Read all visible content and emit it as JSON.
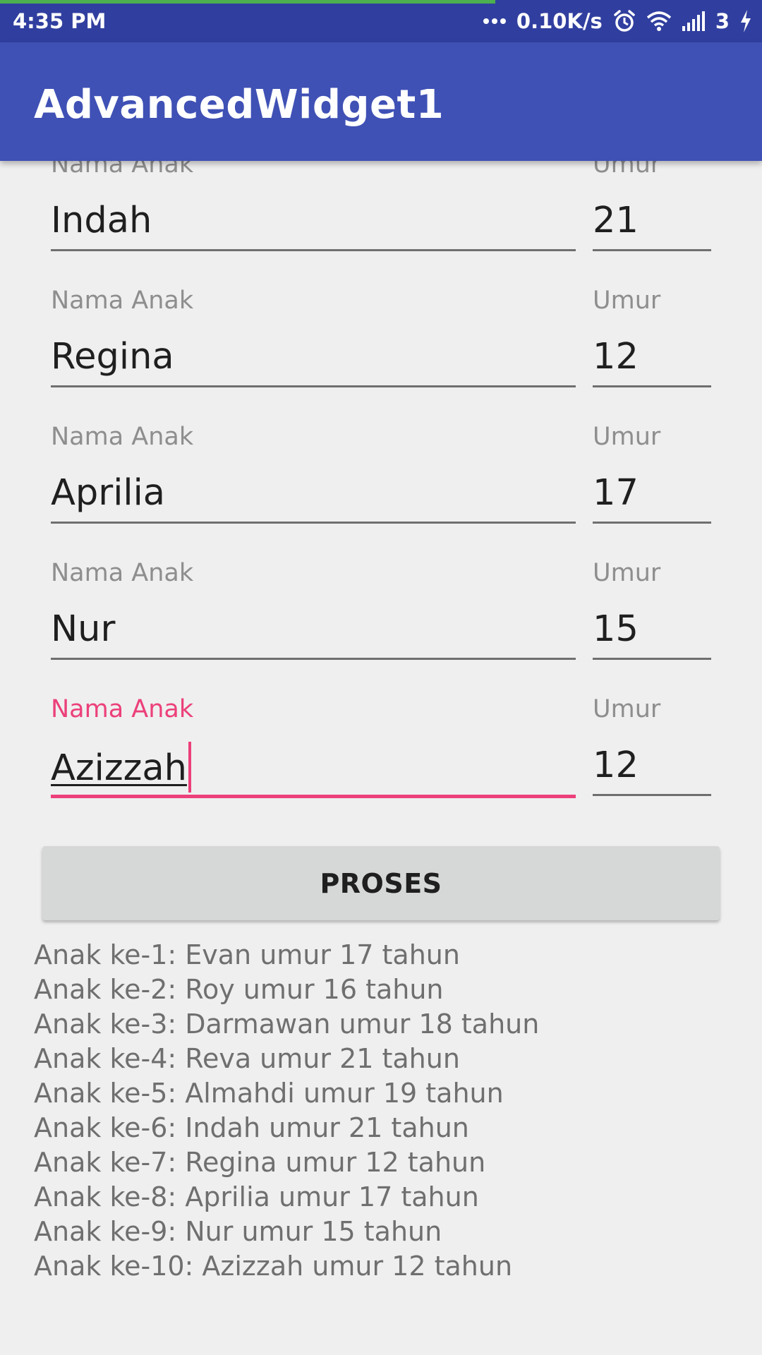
{
  "status_bar": {
    "time": "4:35 PM",
    "network_speed": "0.10K/s",
    "sim_label": "3",
    "icons": [
      "more-dots-icon",
      "alarm-icon",
      "wifi-icon",
      "signal-icon",
      "charging-bolt-icon"
    ],
    "page_load_progress": 0.65
  },
  "app_bar": {
    "title": "AdvancedWidget1"
  },
  "form": {
    "name_label": "Nama Anak",
    "age_label": "Umur",
    "rows": [
      {
        "name": "Indah",
        "age": "21"
      },
      {
        "name": "Regina",
        "age": "12"
      },
      {
        "name": "Aprilia",
        "age": "17"
      },
      {
        "name": "Nur",
        "age": "15"
      },
      {
        "name": "Azizzah",
        "age": "12",
        "focused": true
      }
    ]
  },
  "button": {
    "label": "PROSES"
  },
  "results": [
    "Anak ke-1: Evan umur 17 tahun",
    "Anak ke-2: Roy umur 16 tahun",
    "Anak ke-3: Darmawan umur 18 tahun",
    "Anak ke-4: Reva umur 21 tahun",
    "Anak ke-5: Almahdi umur 19 tahun",
    "Anak ke-6: Indah umur 21 tahun",
    "Anak ke-7: Regina umur 12 tahun",
    "Anak ke-8: Aprilia umur 17 tahun",
    "Anak ke-9: Nur umur 15 tahun",
    "Anak ke-10: Azizzah umur 12 tahun"
  ],
  "colors": {
    "status_bar": "#303f9f",
    "app_bar": "#3f51b5",
    "accent": "#ec407a",
    "progress": "#4caf50",
    "background": "#efefef",
    "button": "#d6d7d7"
  }
}
